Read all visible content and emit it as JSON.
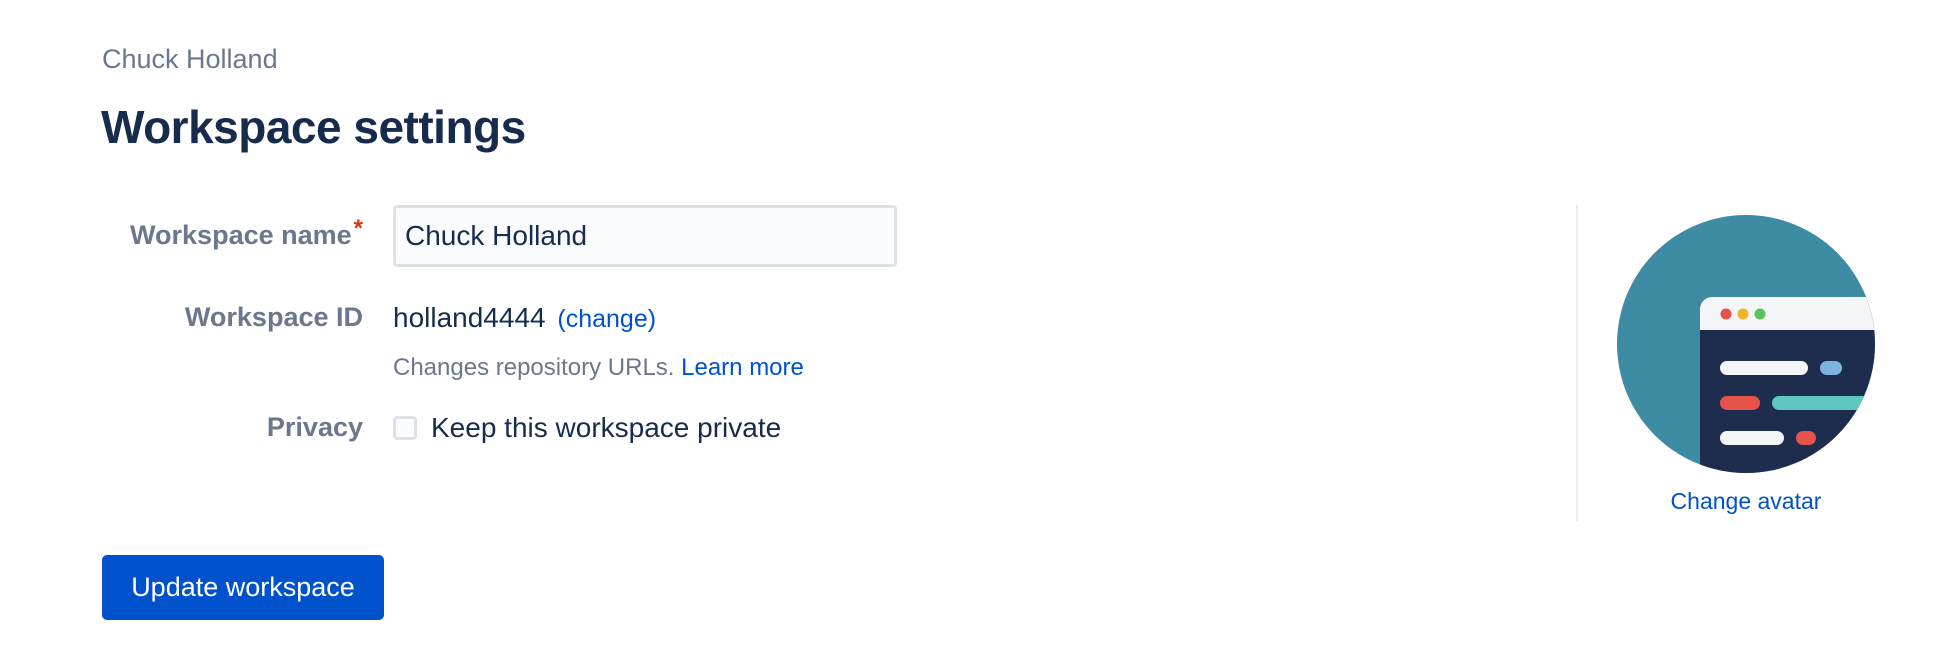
{
  "breadcrumb": "Chuck Holland",
  "page_title": "Workspace settings",
  "form": {
    "name_label": "Workspace name",
    "required_marker": "*",
    "name_value": "Chuck Holland",
    "id_label": "Workspace ID",
    "id_value": "holland4444",
    "change_link": "(change)",
    "help_text": "Changes repository URLs.",
    "learn_more_link": "Learn more",
    "privacy_label": "Privacy",
    "privacy_checkbox_label": "Keep this workspace private",
    "privacy_checked": false
  },
  "submit_button": "Update workspace",
  "avatar": {
    "icon": "workspace-avatar-illustration",
    "change_link": "Change avatar"
  },
  "colors": {
    "primary": "#0052cc",
    "heading": "#172b4d",
    "muted": "#6b778c",
    "required": "#de350b",
    "avatar_background": "#3d8ca3"
  }
}
